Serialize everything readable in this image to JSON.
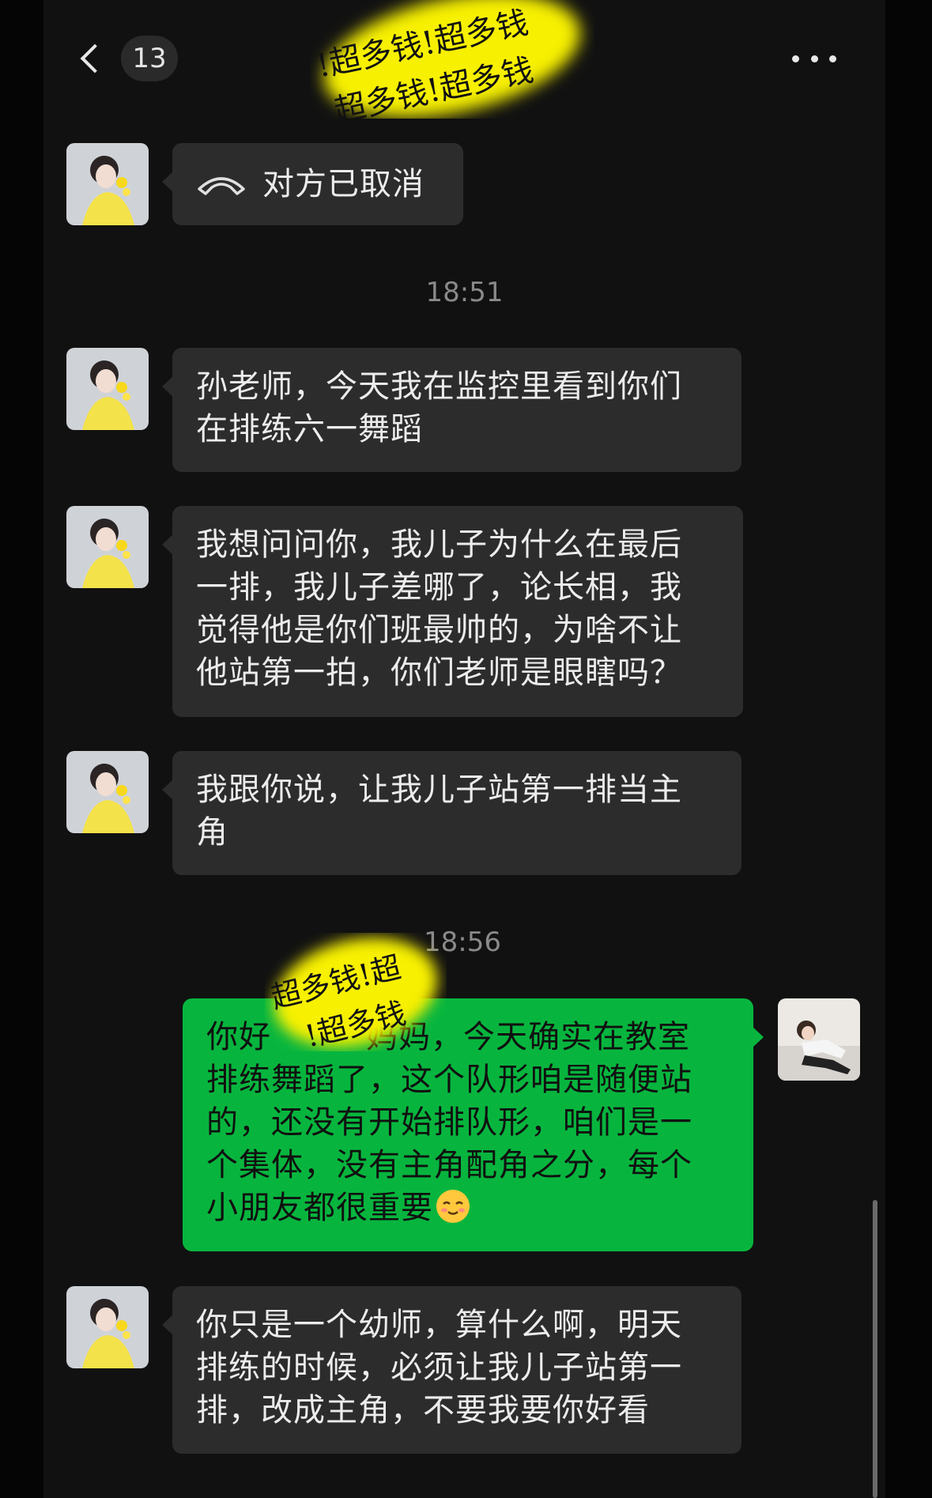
{
  "header": {
    "unread_count": "13",
    "back_icon": "chevron-left-icon",
    "more_icon": "more-horizontal-icon"
  },
  "watermark": {
    "top_line1": "!超多钱!超多钱",
    "top_line2": "超多钱!超多钱",
    "mid_line1": "超多钱!超",
    "mid_line2": "!超多钱"
  },
  "messages": [
    {
      "side": "in",
      "type": "call",
      "text": "对方已取消",
      "icon": "phone-hangup-icon"
    },
    {
      "type": "time",
      "text": "18:51"
    },
    {
      "side": "in",
      "lines": [
        "孙老师，今天我在监控里看到你们",
        "在排练六一舞蹈"
      ]
    },
    {
      "side": "in",
      "lines": [
        "我想问问你，我儿子为什么在最后",
        "一排，我儿子差哪了，论长相，我",
        "觉得他是你们班最帅的，为啥不让",
        "他站第一拍，你们老师是眼瞎吗？"
      ]
    },
    {
      "side": "in",
      "lines": [
        "我跟你说，让我儿子站第一排当主",
        "角"
      ]
    },
    {
      "type": "time",
      "text": "18:56"
    },
    {
      "side": "out",
      "lines": [
        "你好",
        "妈妈，今天确实在教室",
        "排练舞蹈了，这个队形咱是随便站",
        "的，还没有开始排队形，咱们是一",
        "个集体，没有主角配角之分，每个",
        "小朋友都很重要"
      ],
      "emoji": "smiling-face-icon"
    },
    {
      "side": "in",
      "lines": [
        "你只是一个幼师，算什么啊，明天",
        "排练的时候，必须让我儿子站第一",
        "排，改成主角，不要我要你好看"
      ]
    }
  ],
  "colors": {
    "background": "#111111",
    "incoming_bubble": "#2c2c2c",
    "outgoing_bubble": "#07b53e",
    "watermark_highlight": "#f7f000"
  }
}
